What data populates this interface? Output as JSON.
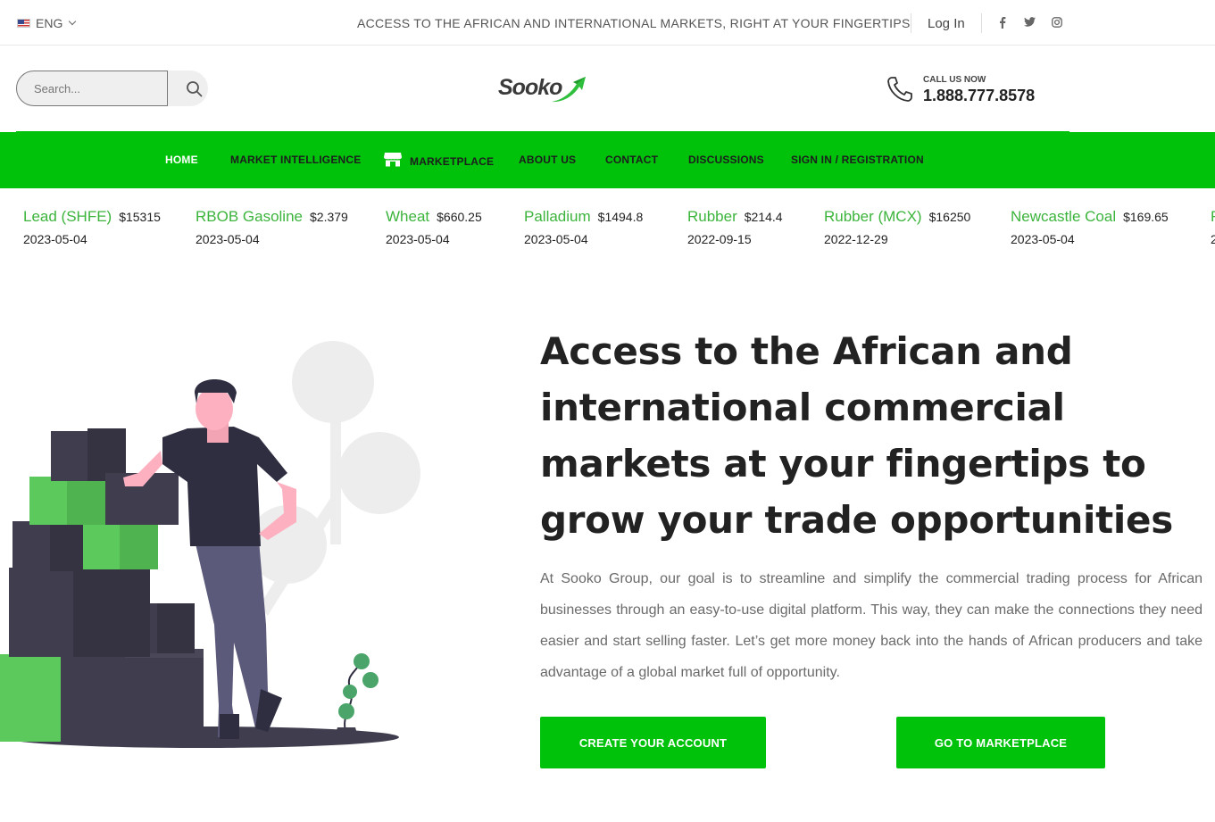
{
  "topbar": {
    "language": "ENG",
    "tagline": "ACCESS TO THE AFRICAN AND INTERNATIONAL MARKETS, RIGHT AT YOUR FINGERTIPS",
    "login": "Log In",
    "social": [
      "facebook-icon",
      "twitter-icon",
      "instagram-icon"
    ]
  },
  "header": {
    "search_placeholder": "Search...",
    "logo_text": "Sooko",
    "call_label": "CALL US NOW",
    "call_number": "1.888.777.8578"
  },
  "nav": {
    "items": [
      {
        "label": "HOME",
        "active": true
      },
      {
        "label": "MARKET INTELLIGENCE"
      },
      {
        "label": "MARKETPLACE",
        "icon": "store-icon"
      },
      {
        "label": "ABOUT US"
      },
      {
        "label": "CONTACT"
      },
      {
        "label": "DISCUSSIONS"
      },
      {
        "label": "SIGN IN / REGISTRATION"
      }
    ]
  },
  "ticker": [
    {
      "name": "Lead (SHFE)",
      "price": "$15315",
      "date": "2023-05-04"
    },
    {
      "name": "RBOB Gasoline",
      "price": "$2.379",
      "date": "2023-05-04"
    },
    {
      "name": "Wheat",
      "price": "$660.25",
      "date": "2023-05-04"
    },
    {
      "name": "Palladium",
      "price": "$1494.8",
      "date": "2023-05-04"
    },
    {
      "name": "Rubber",
      "price": "$214.4",
      "date": "2022-09-15"
    },
    {
      "name": "Rubber (MCX)",
      "price": "$16250",
      "date": "2022-12-29"
    },
    {
      "name": "Newcastle Coal",
      "price": "$169.65",
      "date": "2023-05-04"
    },
    {
      "name": "R",
      "price": "",
      "date": "2"
    }
  ],
  "hero": {
    "title": "Access to the African and international commercial markets at your fingertips to grow your trade opportunities",
    "text": "At Sooko Group, our goal is to streamline and simplify the commercial trading process for African businesses through an easy-to-use digital platform. This way, they can make the connections they need easier and start selling faster. Let’s get more money back into the hands of African producers and take advantage of a global market full of opportunity.",
    "primary_button": "CREATE YOUR ACCOUNT",
    "secondary_button": "GO TO MARKETPLACE"
  },
  "colors": {
    "accent": "#00c20b",
    "ticker_name": "#3cb43c"
  }
}
